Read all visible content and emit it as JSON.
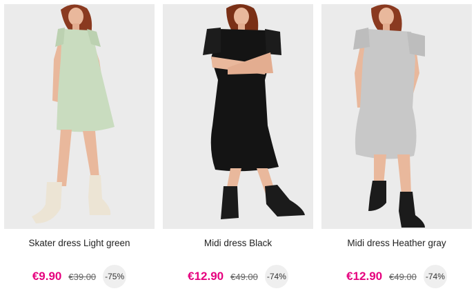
{
  "products": [
    {
      "name": "Skater dress Light green",
      "sale_price": "€9.90",
      "original_price": "€39.00",
      "discount": "-75%",
      "dress_color": "#c9dcbf",
      "boot_color": "#ece4d4"
    },
    {
      "name": "Midi dress Black",
      "sale_price": "€12.90",
      "original_price": "€49.00",
      "discount": "-74%",
      "dress_color": "#141414",
      "boot_color": "#1b1b1b"
    },
    {
      "name": "Midi dress Heather gray",
      "sale_price": "€12.90",
      "original_price": "€49.00",
      "discount": "-74%",
      "dress_color": "#c8c8c8",
      "boot_color": "#1b1b1b"
    }
  ],
  "colors": {
    "sale_price": "#e6007e",
    "photo_background": "#ebebeb",
    "badge_background": "#efefef"
  }
}
